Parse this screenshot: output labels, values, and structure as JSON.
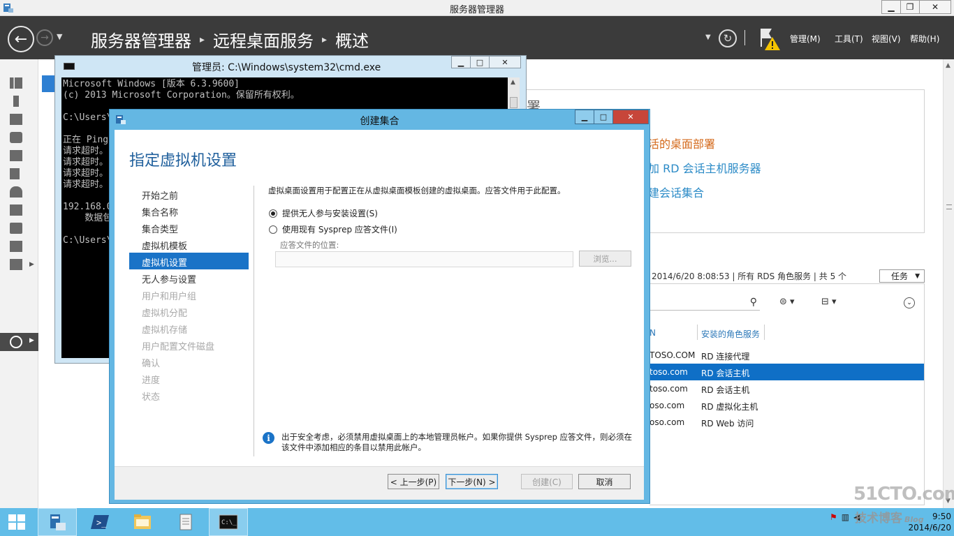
{
  "server_manager": {
    "title": "服务器管理器",
    "breadcrumb": [
      "服务器管理器",
      "远程桌面服务",
      "概述"
    ],
    "menu": [
      "管理(M)",
      "工具(T)",
      "视图(V)",
      "帮助(H)"
    ],
    "background": {
      "panel_title_fragment": "署",
      "links": [
        {
          "text": "活的桌面部署",
          "color": "#d46a1c"
        },
        {
          "text": "加 RD 会话主机服务器",
          "color": "#2c8bc7"
        },
        {
          "text": "建会话集合",
          "color": "#2c8bc7"
        }
      ],
      "status_line": "2014/6/20 8:08:53 | 所有 RDS 角色服务 | 共 5 个",
      "tasks_button": "任务",
      "columns": [
        "N",
        "安装的角色服务"
      ],
      "rows": [
        {
          "server": "TOSO.COM",
          "role": "RD 连接代理",
          "selected": false
        },
        {
          "server": "toso.com",
          "role": "RD 会话主机",
          "selected": true
        },
        {
          "server": "toso.com",
          "role": "RD 会话主机",
          "selected": false
        },
        {
          "server": "oso.com",
          "role": "RD 虚拟化主机",
          "selected": false
        },
        {
          "server": "oso.com",
          "role": "RD Web 访问",
          "selected": false
        }
      ]
    }
  },
  "cmd_window": {
    "title": "管理员: C:\\Windows\\system32\\cmd.exe",
    "lines": [
      "Microsoft Windows [版本 6.3.9600]",
      "(c) 2013 Microsoft Corporation。保留所有权利。",
      "",
      "C:\\Users\\",
      "",
      "正在 Ping",
      "请求超时。",
      "请求超时。",
      "请求超时。",
      "请求超时。",
      "",
      "192.168.0",
      "    数据包",
      "",
      "C:\\Users\\"
    ]
  },
  "dialog": {
    "title": "创建集合",
    "heading": "指定虚拟机设置",
    "steps": [
      {
        "label": "开始之前",
        "state": "normal"
      },
      {
        "label": "集合名称",
        "state": "normal"
      },
      {
        "label": "集合类型",
        "state": "normal"
      },
      {
        "label": "虚拟机模板",
        "state": "normal"
      },
      {
        "label": "虚拟机设置",
        "state": "active"
      },
      {
        "label": "无人参与设置",
        "state": "normal"
      },
      {
        "label": "用户和用户组",
        "state": "disabled"
      },
      {
        "label": "虚拟机分配",
        "state": "disabled"
      },
      {
        "label": "虚拟机存储",
        "state": "disabled"
      },
      {
        "label": "用户配置文件磁盘",
        "state": "disabled"
      },
      {
        "label": "确认",
        "state": "disabled"
      },
      {
        "label": "进度",
        "state": "disabled"
      },
      {
        "label": "状态",
        "state": "disabled"
      }
    ],
    "description": "虚拟桌面设置用于配置正在从虚拟桌面模板创建的虚拟桌面。应答文件用于此配置。",
    "options": [
      {
        "label": "提供无人参与安装设置(S)",
        "checked": true
      },
      {
        "label": "使用现有 Sysprep 应答文件(I)",
        "checked": false
      }
    ],
    "answer_file_label": "应答文件的位置:",
    "answer_file_value": "",
    "browse_label": "浏览...",
    "info_text": "出于安全考虑，必须禁用虚拟桌面上的本地管理员帐户。如果你提供 Sysprep 应答文件，则必须在该文件中添加相应的条目以禁用此帐户。",
    "buttons": {
      "prev": "< 上一步(P)",
      "next": "下一步(N) >",
      "create": "创建(C)",
      "cancel": "取消"
    }
  },
  "taskbar": {
    "time": "9:50",
    "date": "2014/6/20"
  },
  "watermark": {
    "logo": "51CTO.com",
    "sub": "技术博客",
    "tag": "Blog"
  }
}
